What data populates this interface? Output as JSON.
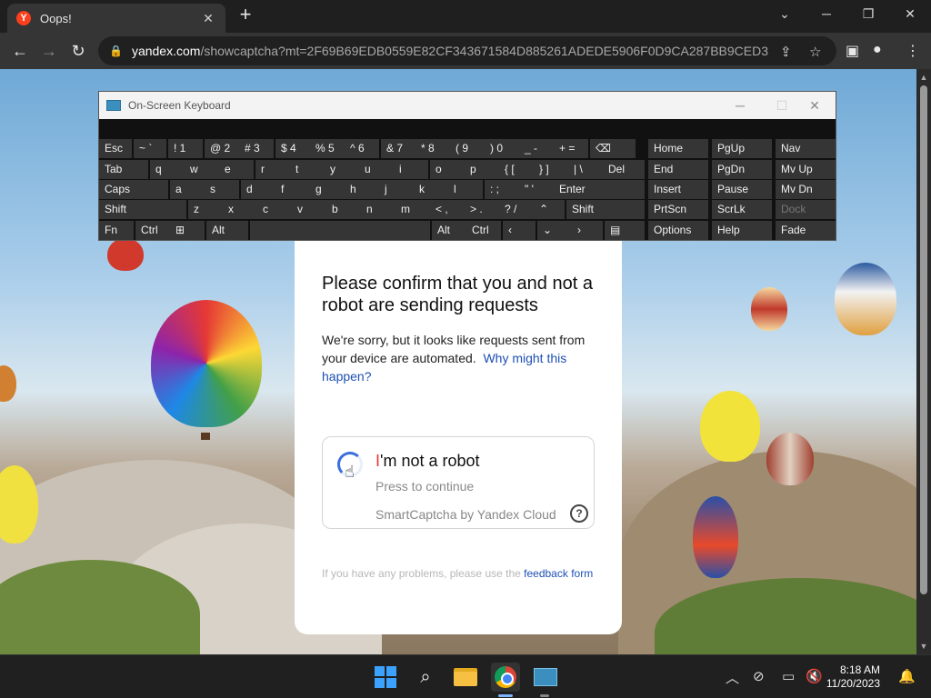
{
  "browser": {
    "tab_title": "Oops!",
    "tab_favicon_letter": "Y",
    "new_tab": "+",
    "url_host": "yandex.com",
    "url_path": "/showcaptcha?mt=2F69B69EDB0559E82CF343671584D885261ADEDE5906F0D9CA287BB9CED30D96...",
    "accent_color": "#fc3f1d"
  },
  "captcha": {
    "title": "Please confirm that you and not a robot are sending requests",
    "text": "We're sorry, but it looks like requests sent from your device are automated.",
    "why_link": "Why might this happen?",
    "robot_accent": "I",
    "robot_rest": "'m not a robot",
    "press_text": "Press to continue",
    "brand": "SmartCaptcha by Yandex Cloud",
    "help_glyph": "?",
    "footnote": "If you have any problems, please use the",
    "footnote_link": "feedback form"
  },
  "osk": {
    "title": "On-Screen Keyboard",
    "rows": [
      [
        "Esc",
        "~ `",
        "! 1",
        "@ 2",
        "# 3",
        "$ 4",
        "% 5",
        "^ 6",
        "& 7",
        "* 8",
        "( 9",
        ") 0",
        "_ -",
        "+ ="
      ],
      [
        "Tab",
        "q",
        "w",
        "e",
        "r",
        "t",
        "y",
        "u",
        "i",
        "o",
        "p",
        "{ [",
        "} ]",
        "| \\",
        "Del"
      ],
      [
        "Caps",
        "a",
        "s",
        "d",
        "f",
        "g",
        "h",
        "j",
        "k",
        "l",
        ": ;",
        "\" '",
        "Enter"
      ],
      [
        "Shift",
        "z",
        "x",
        "c",
        "v",
        "b",
        "n",
        "m",
        "< ,",
        "> .",
        "? /",
        "Shift"
      ],
      [
        "Fn",
        "Ctrl",
        "Alt",
        "Alt",
        "Ctrl"
      ]
    ],
    "nav_rows": [
      [
        "Home",
        "PgUp",
        "Nav"
      ],
      [
        "End",
        "PgDn",
        "Mv Up"
      ],
      [
        "Insert",
        "Pause",
        "Mv Dn"
      ],
      [
        "PrtScn",
        "ScrLk",
        "Dock"
      ],
      [
        "Options",
        "Help",
        "Fade"
      ]
    ]
  },
  "taskbar": {
    "time": "8:18 AM",
    "date": "11/20/2023"
  }
}
